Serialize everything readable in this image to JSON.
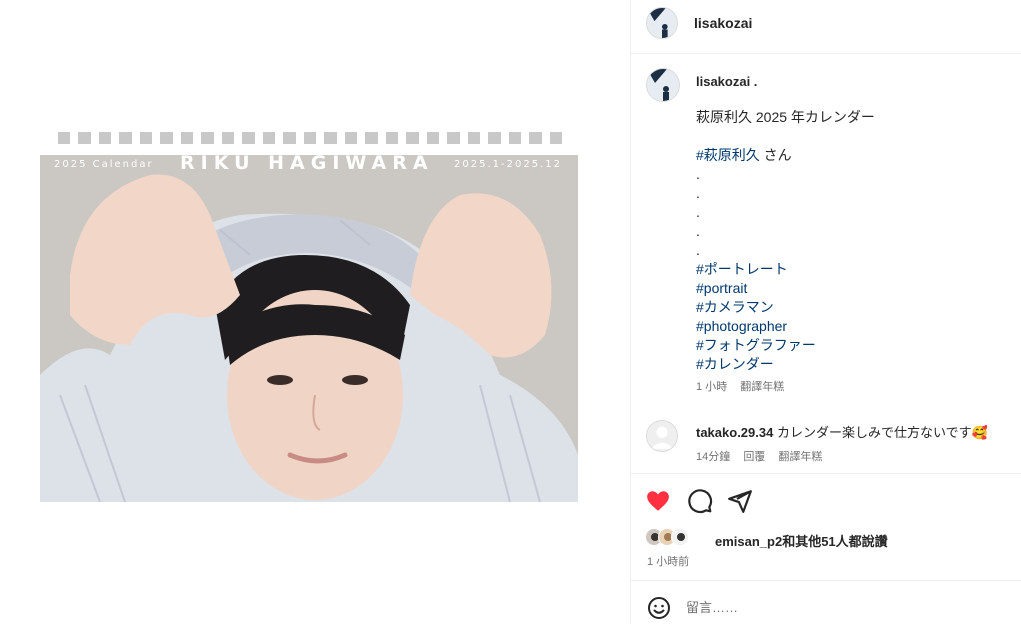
{
  "post": {
    "calendar_left": "2025 Calendar",
    "calendar_center": "RIKU HAGIWARA",
    "calendar_right": "2025.1-2025.12"
  },
  "header": {
    "username": "lisakozai"
  },
  "caption": {
    "username": "lisakozai .",
    "title": "萩原利久 2025 年カレンダー",
    "mention_tag": "#萩原利久",
    "mention_suffix": " さん",
    "dots": [
      ".",
      ".",
      ".",
      ".",
      "."
    ],
    "hashtags": [
      "#ポートレート",
      "#portrait",
      "#カメラマン",
      "#photographer",
      "#フォトグラファー",
      "#カレンダー"
    ],
    "time": "1 小時",
    "translate": "翻譯年糕"
  },
  "comment": {
    "username": "takako.29.34",
    "text": " カレンダー楽しみで仕方ないです🥰",
    "time": "14分鐘",
    "reply": "回覆",
    "translate": "翻譯年糕"
  },
  "actions": {
    "like_icon": "heart-filled-icon",
    "comment_icon": "comment-icon",
    "share_icon": "share-icon",
    "like_color": "#ff3040"
  },
  "likes": {
    "text": "emisan_p2和其他51人都說讚"
  },
  "posted": "1 小時前",
  "add_comment": {
    "placeholder": "留言……",
    "emoji_icon": "emoji-icon"
  }
}
